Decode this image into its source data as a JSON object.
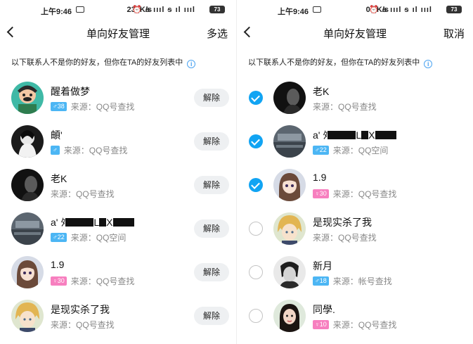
{
  "status": {
    "time": "上午9:46",
    "left_speed": "238K/s",
    "right_speed": "0.3K/s",
    "icons": "⏰ ᵴ ıııl ᵴ ıl ıııl",
    "battery": "73"
  },
  "left": {
    "title": "单向好友管理",
    "action": "多选",
    "notice": "以下联系人不是你的好友，但你在TA的好友列表中",
    "items": [
      {
        "name": "醒着做梦",
        "badge": "♂38",
        "source": "来源：QQ号查找",
        "button": "解除"
      },
      {
        "name": "頔'",
        "badge": "♂",
        "source": "来源：QQ号查找",
        "button": "解除"
      },
      {
        "name": "老K",
        "badge": "",
        "source": "来源：QQ号查找",
        "button": "解除"
      },
      {
        "name": "a' ﾀ",
        "name_tail": "L",
        "name_tail2": "X",
        "badge": "♂22",
        "source": "来源：QQ空间",
        "button": "解除"
      },
      {
        "name": "1.9",
        "badge": "♀30",
        "source": "来源：QQ号查找",
        "button": "解除"
      },
      {
        "name": "是现实杀了我",
        "badge": "",
        "source": "来源：QQ号查找",
        "button": "解除"
      }
    ]
  },
  "right": {
    "title": "单向好友管理",
    "action": "取消",
    "notice": "以下联系人不是你的好友，但你在TA的好友列表中",
    "items": [
      {
        "name": "老K",
        "badge": "",
        "source": "来源：QQ号查找",
        "checked": true
      },
      {
        "name": "a' ﾀ",
        "name_tail": "L",
        "name_tail2": "X",
        "badge": "♂22",
        "source": "来源：QQ空间",
        "checked": true
      },
      {
        "name": "1.9",
        "badge": "♀30",
        "source": "来源：QQ号查找",
        "checked": true
      },
      {
        "name": "是现实杀了我",
        "badge": "",
        "source": "来源：QQ号查找",
        "checked": false
      },
      {
        "name": "新月",
        "badge": "♂18",
        "source": "来源：帐号查找",
        "checked": false
      },
      {
        "name": "同學.",
        "badge": "♀10",
        "source": "来源：QQ号查找",
        "checked": false
      }
    ]
  },
  "icons": {
    "back": "back-arrow-icon",
    "info": "info-icon",
    "check": "check-icon"
  },
  "colors": {
    "accent": "#11a4f3",
    "male_badge": "#4cb6f4",
    "female_badge": "#f77fbf",
    "button_bg": "#eef0f2"
  }
}
